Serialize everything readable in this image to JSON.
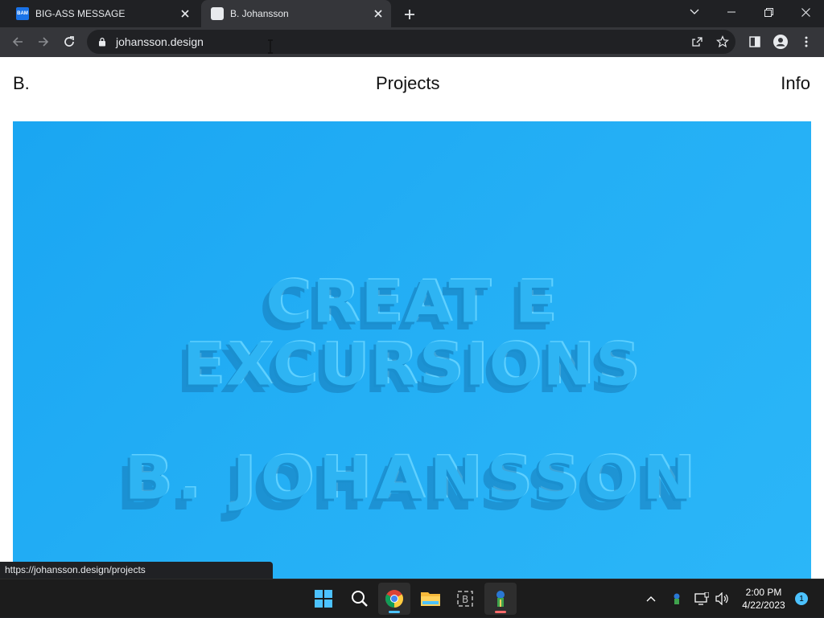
{
  "browser": {
    "tabs": [
      {
        "title": "BIG-ASS MESSAGE",
        "favicon_text": "BAM",
        "active": false
      },
      {
        "title": "B. Johansson",
        "active": true
      }
    ],
    "url": "johansson.design",
    "status_url": "https://johansson.design/projects"
  },
  "site": {
    "nav": {
      "logo": "B.",
      "projects": "Projects",
      "info": "Info"
    },
    "hero": {
      "line1": "CREAT    E",
      "line2": "EXCURSIONS",
      "line3": "B. JOHANSSON",
      "background_color": "#24aff5"
    }
  },
  "taskbar": {
    "apps": [
      "start-icon",
      "search-icon",
      "chrome-icon",
      "file-explorer-icon",
      "app-icon",
      "stocks-app-icon"
    ],
    "time": "2:00 PM",
    "date": "4/22/2023",
    "notification_count": "1"
  },
  "colors": {
    "browser_dark": "#202124",
    "browser_toolbar": "#35363a",
    "accent": "#4cc2ff"
  }
}
